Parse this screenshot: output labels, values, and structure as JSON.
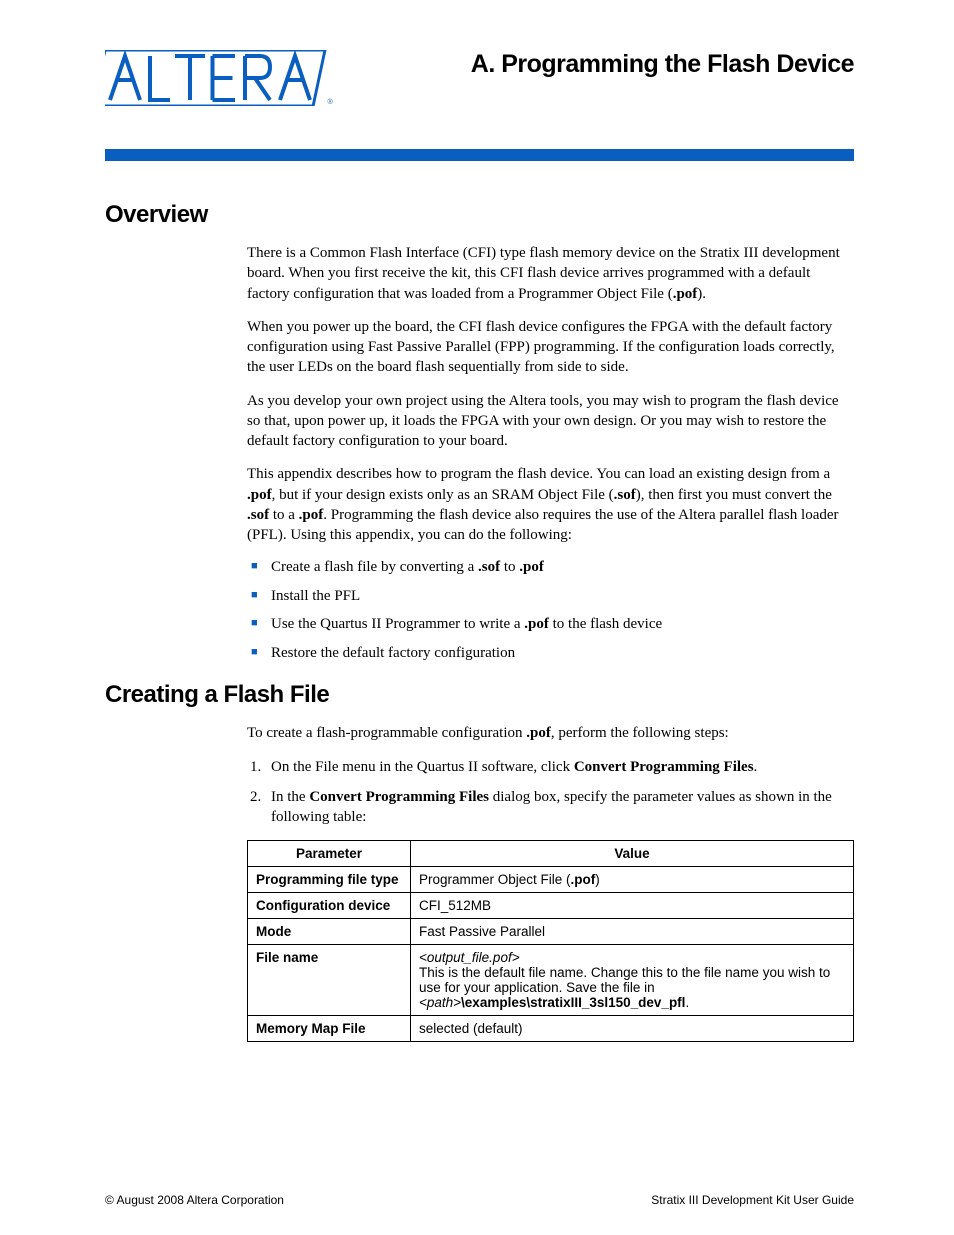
{
  "page_title": "A.  Programming the Flash Device",
  "sections": {
    "overview": {
      "heading": "Overview",
      "p1_a": "There is a Common Flash Interface (CFI) type flash memory device on the Stratix III development board. When you first receive the kit, this CFI flash device arrives programmed with a default factory configuration that was loaded from a Programmer Object File (",
      "p1_b": ".pof",
      "p1_c": ").",
      "p2": "When you power up the board, the CFI flash device configures the FPGA with the default factory configuration using Fast Passive Parallel (FPP) programming. If the configuration loads correctly, the user LEDs on the board flash sequentially from side to side.",
      "p3": "As you develop your own project using the Altera tools, you may wish to program the flash device so that, upon power up, it loads the FPGA with your own design. Or you may wish to restore the default factory configuration to your board.",
      "p4_a": "This appendix describes how to program the flash device. You can load an existing design from a ",
      "p4_b": ".pof",
      "p4_c": ", but if your design exists only as an SRAM Object File (",
      "p4_d": ".sof",
      "p4_e": "), then first you must convert the ",
      "p4_f": ".sof",
      "p4_g": " to a ",
      "p4_h": ".pof",
      "p4_i": ". Programming the flash device also requires the use of the Altera parallel flash loader (PFL). Using this appendix, you can do the following:",
      "bullets": {
        "b1_a": "Create a flash file by converting a ",
        "b1_b": ".sof",
        "b1_c": " to ",
        "b1_d": ".pof",
        "b2": "Install the PFL",
        "b3_a": "Use the Quartus II Programmer to write a ",
        "b3_b": ".pof",
        "b3_c": " to the flash device",
        "b4": "Restore the default factory configuration"
      }
    },
    "creating": {
      "heading": "Creating a Flash File",
      "p1_a": "To create a flash-programmable configuration ",
      "p1_b": ".pof",
      "p1_c": ", perform the following steps:",
      "step1_a": "On the File menu in the Quartus II software, click ",
      "step1_b": "Convert Programming Files",
      "step1_c": ".",
      "step2_a": "In the ",
      "step2_b": "Convert Programming Files",
      "step2_c": " dialog box, specify the parameter values as shown in the following table:"
    }
  },
  "table": {
    "headers": {
      "param": "Parameter",
      "value": "Value"
    },
    "rows": {
      "r1p": "Programming file type",
      "r1v_a": "Programmer Object File (",
      "r1v_b": ".pof",
      "r1v_c": ")",
      "r2p": "Configuration device",
      "r2v": "CFI_512MB",
      "r3p": "Mode",
      "r3v": "Fast Passive Parallel",
      "r4p": "File name",
      "r4v_a": "<output_file.pof>",
      "r4v_b": "This is the default file name. Change this to the file name you wish to use for your application. Save the file in",
      "r4v_c": "<path>",
      "r4v_d": "\\examples\\stratixIII_3sl150_dev_pfl",
      "r4v_e": ".",
      "r5p": "Memory Map File",
      "r5v": "selected (default)"
    }
  },
  "footer": {
    "left": "© August 2008   Altera Corporation",
    "right": "Stratix III Development Kit User Guide"
  }
}
